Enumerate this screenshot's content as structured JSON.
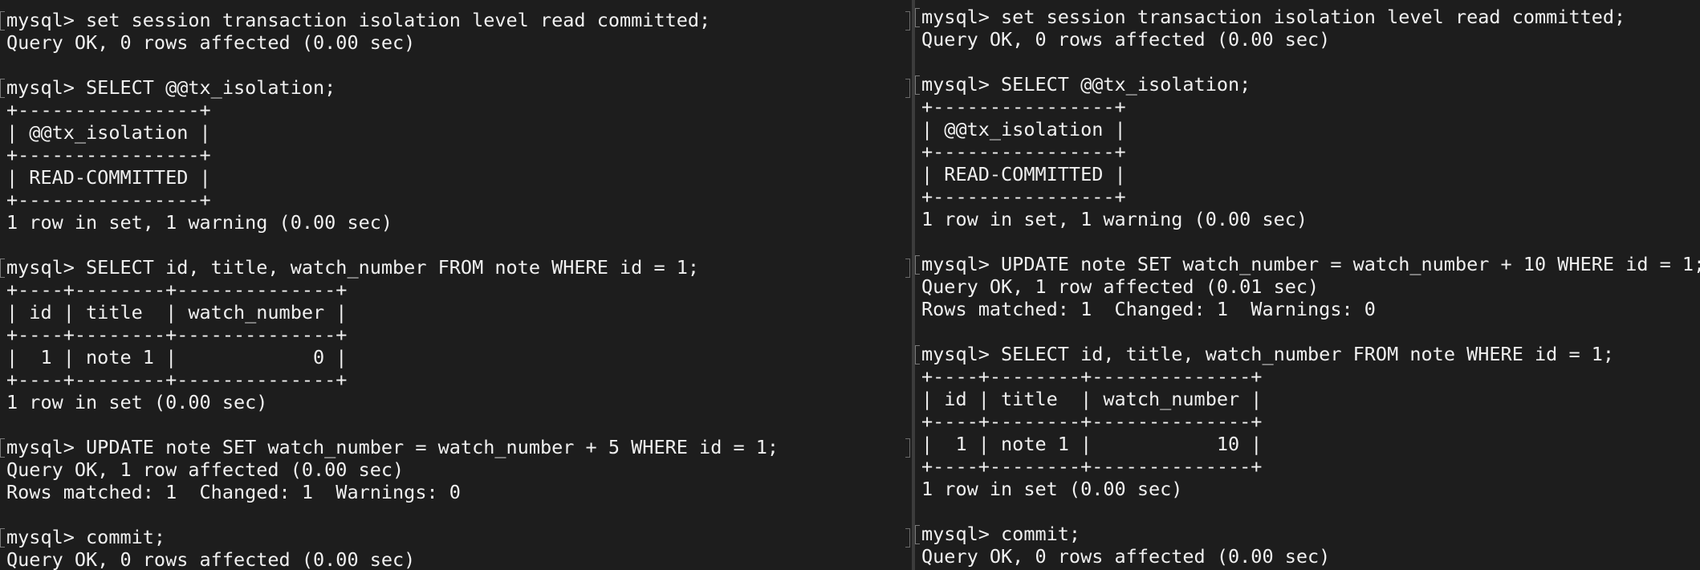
{
  "left_pane": {
    "lines": [
      "mysql> set session transaction isolation level read committed;",
      "Query OK, 0 rows affected (0.00 sec)",
      "",
      "mysql> SELECT @@tx_isolation;",
      "+----------------+",
      "| @@tx_isolation |",
      "+----------------+",
      "| READ-COMMITTED |",
      "+----------------+",
      "1 row in set, 1 warning (0.00 sec)",
      "",
      "mysql> SELECT id, title, watch_number FROM note WHERE id = 1;",
      "+----+--------+--------------+",
      "| id | title  | watch_number |",
      "+----+--------+--------------+",
      "|  1 | note 1 |            0 |",
      "+----+--------+--------------+",
      "1 row in set (0.00 sec)",
      "",
      "mysql> UPDATE note SET watch_number = watch_number + 5 WHERE id = 1;",
      "Query OK, 1 row affected (0.00 sec)",
      "Rows matched: 1  Changed: 1  Warnings: 0",
      "",
      "mysql> commit;",
      "Query OK, 0 rows affected (0.00 sec)"
    ]
  },
  "right_pane": {
    "lines": [
      "mysql> set session transaction isolation level read committed;",
      "Query OK, 0 rows affected (0.00 sec)",
      "",
      "mysql> SELECT @@tx_isolation;",
      "+----------------+",
      "| @@tx_isolation |",
      "+----------------+",
      "| READ-COMMITTED |",
      "+----------------+",
      "1 row in set, 1 warning (0.00 sec)",
      "",
      "mysql> UPDATE note SET watch_number = watch_number + 10 WHERE id = 1;",
      "Query OK, 1 row affected (0.01 sec)",
      "Rows matched: 1  Changed: 1  Warnings: 0",
      "",
      "mysql> SELECT id, title, watch_number FROM note WHERE id = 1;",
      "+----+--------+--------------+",
      "| id | title  | watch_number |",
      "+----+--------+--------------+",
      "|  1 | note 1 |           10 |",
      "+----+--------+--------------+",
      "1 row in set (0.00 sec)",
      "",
      "mysql> commit;",
      "Query OK, 0 rows affected (0.00 sec)"
    ]
  },
  "colors": {
    "background": "#1d1d1d",
    "text": "#f0f0f0",
    "divider": "#3c3c3c"
  }
}
